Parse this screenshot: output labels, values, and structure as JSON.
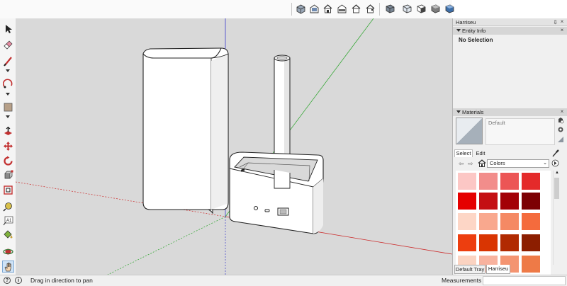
{
  "top_toolbar": {
    "views": [
      "iso-view-icon",
      "top-view-icon",
      "front-view-icon",
      "right-view-icon",
      "back-view-icon",
      "left-view-icon"
    ],
    "styles": [
      "xray-style-icon",
      "wireframe-style-icon",
      "hidden-line-style-icon",
      "shaded-style-icon",
      "shaded-textures-style-icon",
      "monochrome-style-icon"
    ]
  },
  "left_tools": [
    "select-icon",
    "eraser-icon",
    "line-icon",
    "arc-icon",
    "rectangle-icon",
    "push-pull-icon",
    "move-icon",
    "rotate-icon",
    "scale-icon",
    "offset-icon",
    "tape-measure-icon",
    "text-icon",
    "paint-bucket-icon",
    "orbit-icon",
    "pan-icon"
  ],
  "tray": {
    "title": "Harriseu",
    "pin": "⇩",
    "close": "×",
    "entity_info": {
      "header": "Entity Info",
      "value": "No Selection"
    },
    "materials": {
      "header": "Materials",
      "current": "Default",
      "tabs": [
        "Select",
        "Edit"
      ],
      "library": "Colors",
      "swatches": [
        [
          "#fcc7c5",
          "#f28d8b",
          "#ec5555",
          "#e42a2a"
        ],
        [
          "#e50000",
          "#c40f13",
          "#a30006",
          "#7c0003"
        ],
        [
          "#fdd6c6",
          "#f9a88e",
          "#f58964",
          "#f46b3d"
        ],
        [
          "#ed3e0f",
          "#d93502",
          "#b12a01",
          "#8c1e00"
        ],
        [
          "#fbd3c1",
          "#f8b29e",
          "#f49471",
          "#ee7a47"
        ]
      ]
    },
    "bottom_tabs": [
      "Default Tray",
      "Harriseu"
    ]
  },
  "status": {
    "message": "Drag in direction to pan",
    "measurements_label": "Measurements"
  },
  "colors": {
    "viewport_bg": "#d9d9d9",
    "axis_red": "#cc2b2b",
    "axis_green": "#27a327",
    "axis_blue": "#3b3bcc"
  }
}
